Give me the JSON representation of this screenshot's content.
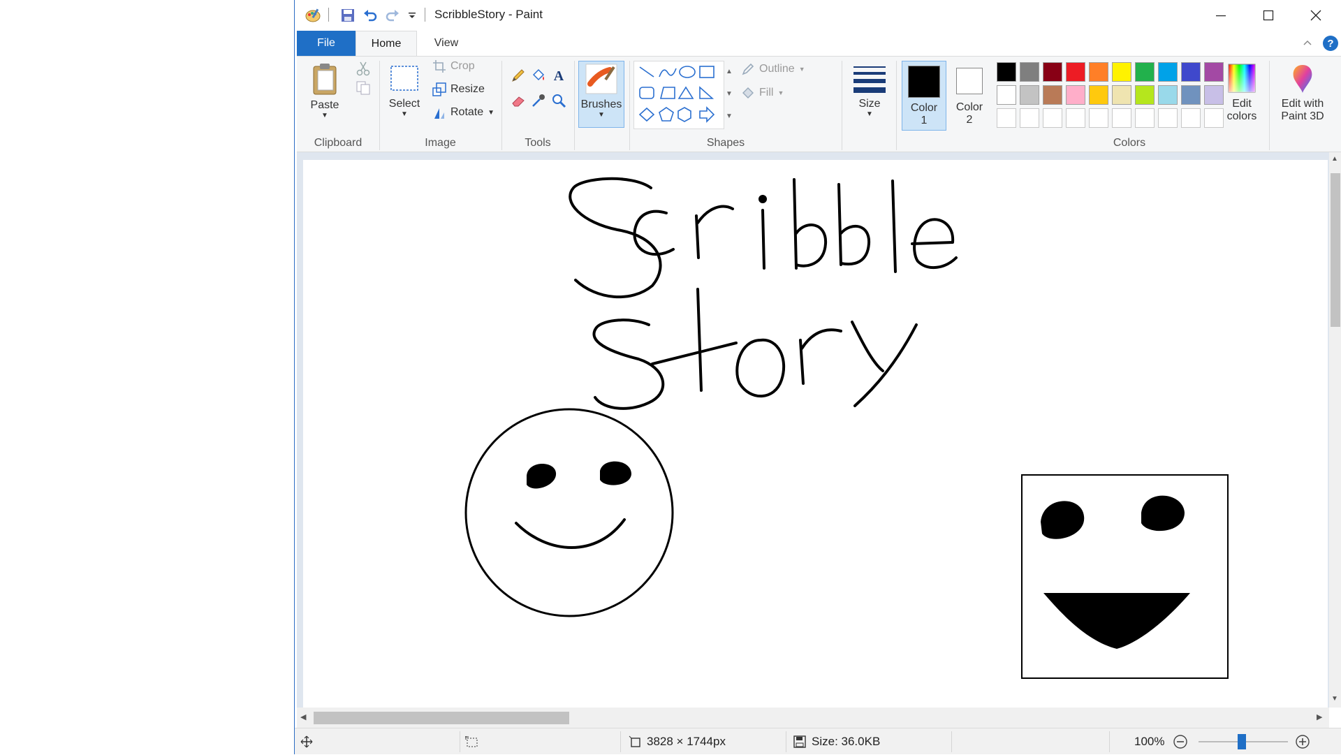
{
  "window": {
    "title": "ScribbleStory - Paint"
  },
  "tabs": {
    "file": "File",
    "home": "Home",
    "view": "View"
  },
  "ribbon": {
    "clipboard": {
      "paste": "Paste",
      "group": "Clipboard"
    },
    "image": {
      "select": "Select",
      "crop": "Crop",
      "resize": "Resize",
      "rotate": "Rotate",
      "group": "Image"
    },
    "tools": {
      "group": "Tools"
    },
    "brushes": {
      "label": "Brushes"
    },
    "shapes": {
      "outline": "Outline",
      "fill": "Fill",
      "group": "Shapes"
    },
    "size": {
      "label": "Size"
    },
    "color1": {
      "line1": "Color",
      "line2": "1"
    },
    "color2": {
      "line1": "Color",
      "line2": "2"
    },
    "colors": {
      "group": "Colors",
      "row1": [
        "#000000",
        "#7f7f7f",
        "#880015",
        "#ed1c24",
        "#ff7f27",
        "#fff200",
        "#22b14c",
        "#00a2e8",
        "#3f48cc",
        "#a349a4"
      ],
      "row2": [
        "#ffffff",
        "#c3c3c3",
        "#b97a57",
        "#ffaec9",
        "#ffc90e",
        "#efe4b0",
        "#b5e61d",
        "#99d9ea",
        "#7092be",
        "#c8bfe7"
      ],
      "row3": [
        "#ffffff",
        "#ffffff",
        "#ffffff",
        "#ffffff",
        "#ffffff",
        "#ffffff",
        "#ffffff",
        "#ffffff",
        "#ffffff",
        "#ffffff"
      ],
      "edit_line1": "Edit",
      "edit_line2": "colors"
    },
    "paint3d": {
      "line1": "Edit with",
      "line2": "Paint 3D"
    }
  },
  "status": {
    "dimensions": "3828 × 1744px",
    "size": "Size: 36.0KB",
    "zoom": "100%"
  }
}
